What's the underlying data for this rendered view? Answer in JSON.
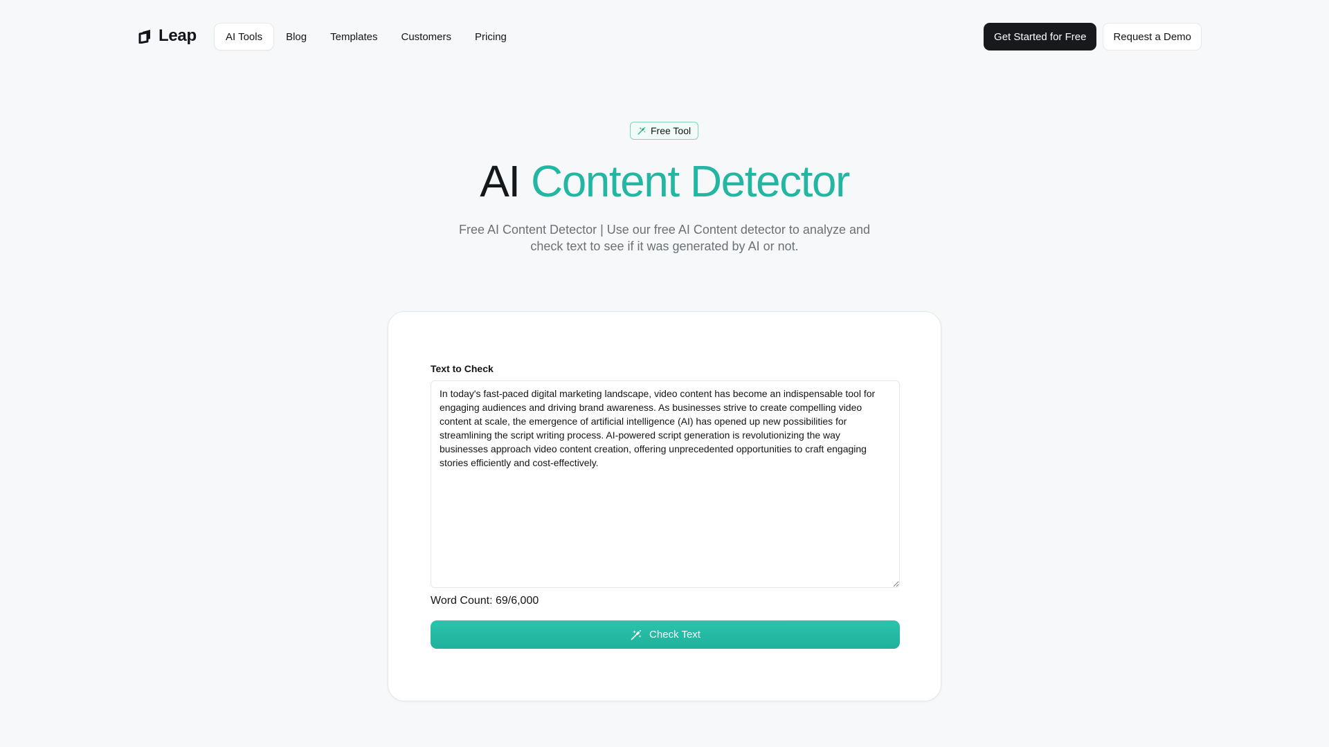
{
  "brand": {
    "name": "Leap",
    "accent_color": "#23b6a2"
  },
  "nav": {
    "links": [
      {
        "label": "AI Tools",
        "active": true
      },
      {
        "label": "Blog",
        "active": false
      },
      {
        "label": "Templates",
        "active": false
      },
      {
        "label": "Customers",
        "active": false
      },
      {
        "label": "Pricing",
        "active": false
      }
    ],
    "cta_primary": "Get Started for Free",
    "cta_secondary": "Request a Demo"
  },
  "hero": {
    "badge_label": "Free Tool",
    "badge_icon": "magic-wand-icon",
    "title_plain": "AI",
    "title_accent": "Content Detector",
    "subtitle": "Free AI Content Detector | Use our free AI Content detector to analyze and check text to see if it was generated by AI or not."
  },
  "form": {
    "label": "Text to Check",
    "text_value": "In today's fast-paced digital marketing landscape, video content has become an indispensable tool for engaging audiences and driving brand awareness. As businesses strive to create compelling video content at scale, the emergence of artificial intelligence (AI) has opened up new possibilities for streamlining the script writing process. AI-powered script generation is revolutionizing the way businesses approach video content creation, offering unprecedented opportunities to craft engaging stories efficiently and cost-effectively.",
    "word_count": "Word Count: 69/6,000",
    "submit_label": "Check Text",
    "submit_icon": "magic-wand-icon"
  }
}
